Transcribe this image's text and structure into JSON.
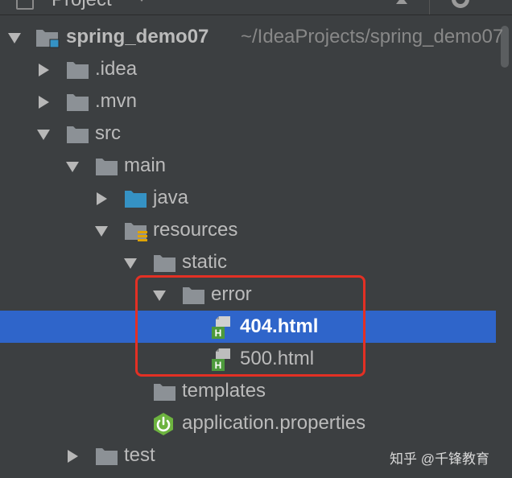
{
  "header": {
    "title": "Project"
  },
  "tree": {
    "project_name": "spring_demo07",
    "project_path": "~/IdeaProjects/spring_demo07",
    "items": {
      "idea": ".idea",
      "mvn": ".mvn",
      "src": "src",
      "main": "main",
      "java": "java",
      "resources": "resources",
      "static": "static",
      "error": "error",
      "file_404": "404.html",
      "file_500": "500.html",
      "templates": "templates",
      "application_properties": "application.properties",
      "test": "test"
    },
    "html_icon_letter": "H"
  },
  "colors": {
    "background": "#3c3f41",
    "selection": "#2f65ca",
    "highlight": "#e33024",
    "folder": "#8c9196",
    "source_folder": "#3592c4",
    "spring": "#6db33f"
  },
  "watermark": "知乎 @千锋教育"
}
